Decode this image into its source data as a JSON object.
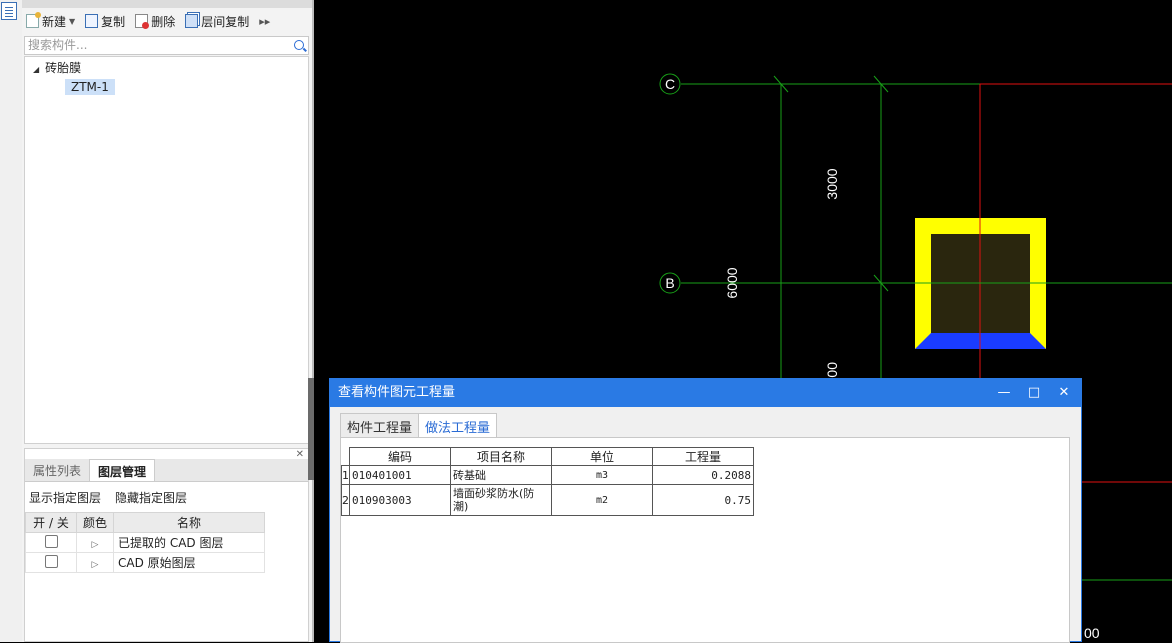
{
  "toolbar": {
    "new_label": "新建",
    "copy_label": "复制",
    "delete_label": "删除",
    "floor_copy_label": "层间复制"
  },
  "search": {
    "placeholder": "搜索构件..."
  },
  "tree": {
    "root_label": "砖胎膜",
    "child_label": "ZTM-1"
  },
  "bottom_panel": {
    "tabs": [
      "属性列表",
      "图层管理"
    ],
    "show_layer": "显示指定图层",
    "hide_layer": "隐藏指定图层",
    "headers": [
      "开 / 关",
      "颜色",
      "名称"
    ],
    "rows": [
      "已提取的 CAD 图层",
      "CAD 原始图层"
    ]
  },
  "canvas": {
    "axis_c": "C",
    "axis_b": "B",
    "dim_3000": "3000",
    "dim_6000": "6000",
    "dim_partial": "00",
    "dim_bottom": "00",
    "colors": {
      "grid": "#18a018",
      "red": "#e01010",
      "yellow": "#ffff00",
      "blue": "#1a3cff",
      "fill": "#2a260e"
    }
  },
  "dialog": {
    "title": "查看构件图元工程量",
    "tabs": [
      "构件工程量",
      "做法工程量"
    ],
    "headers": [
      "编码",
      "项目名称",
      "单位",
      "工程量"
    ],
    "rows": [
      {
        "no": "1",
        "code": "010401001",
        "name": "砖基础",
        "unit": "m3",
        "qty": "0.2088"
      },
      {
        "no": "2",
        "code": "010903003",
        "name": "墙面砂浆防水(防潮)",
        "unit": "m2",
        "qty": "0.75"
      }
    ]
  }
}
